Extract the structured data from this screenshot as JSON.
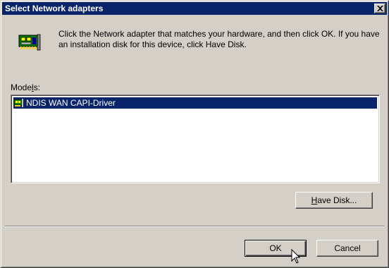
{
  "window": {
    "title": "Select Network adapters"
  },
  "intro": {
    "message": "Click the Network adapter that matches your hardware, and then click OK. If you have an installation disk for this device, click Have Disk."
  },
  "models": {
    "label_prefix": "Mode",
    "label_hotkey": "l",
    "label_suffix": "s:",
    "items": [
      {
        "label": "NDIS WAN CAPI-Driver",
        "selected": true,
        "icon": "network-card-icon"
      }
    ]
  },
  "buttons": {
    "have_disk_hotkey": "H",
    "have_disk_rest": "ave Disk...",
    "ok": "OK",
    "cancel": "Cancel"
  },
  "colors": {
    "titlebar": "#0a246a",
    "selection": "#0a246a",
    "face": "#d4d0c8"
  }
}
